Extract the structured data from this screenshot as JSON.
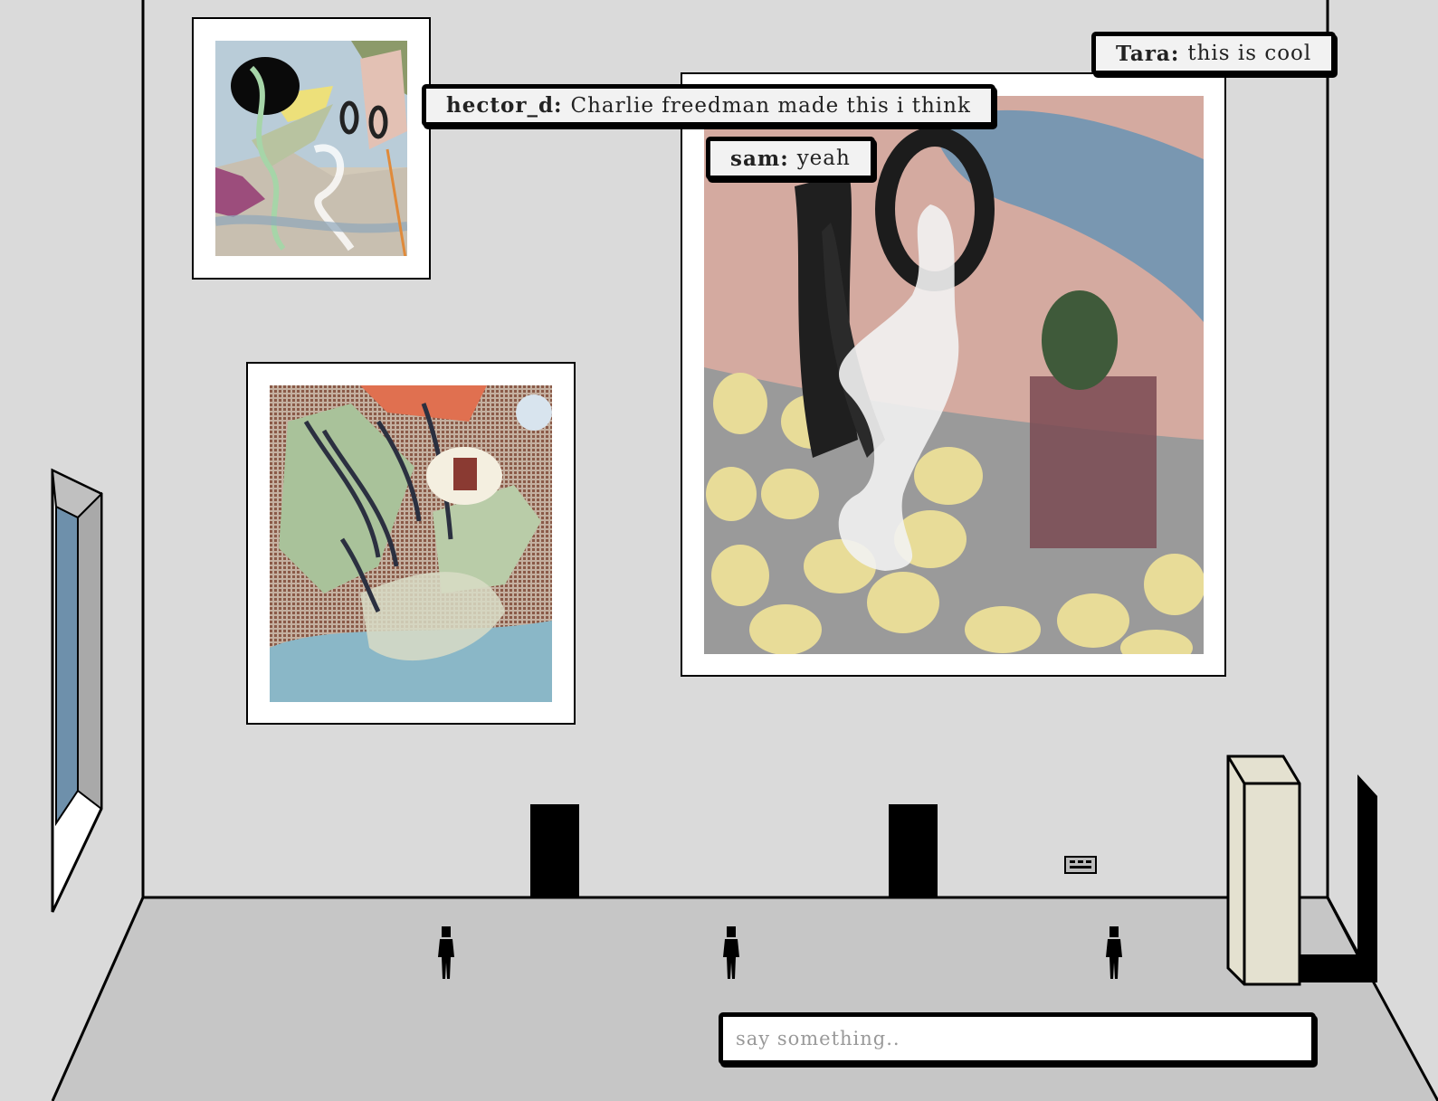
{
  "gallery": {
    "artworks": [
      {
        "id": "artwork-top-left"
      },
      {
        "id": "artwork-bottom-left"
      },
      {
        "id": "artwork-large-right"
      }
    ]
  },
  "chat": {
    "messages": [
      {
        "user": "Tara:",
        "text": "this is cool"
      },
      {
        "user": "hector_d:",
        "text": "Charlie freedman made this i think"
      },
      {
        "user": "sam:",
        "text": "yeah"
      }
    ],
    "input_placeholder": "say something.."
  },
  "colors": {
    "wall": "#dadada",
    "floor": "#c6c6c6",
    "line": "#000000",
    "window_glass": "#6e90ab",
    "cabinet": "#e4e1d0"
  }
}
